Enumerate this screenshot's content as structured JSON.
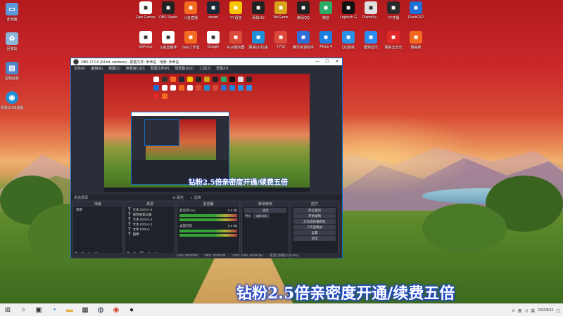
{
  "desktop": {
    "icons_row1": [
      {
        "label": "Epic Games",
        "icon": "epic-icon",
        "color": "#ffffff"
      },
      {
        "label": "OBS Studio",
        "icon": "obs-icon",
        "color": "#222222"
      },
      {
        "label": "斗鱼直播",
        "icon": "douyu-icon",
        "color": "#f26b21"
      },
      {
        "label": "steam",
        "icon": "steam-icon",
        "color": "#1b2838"
      },
      {
        "label": "YY语音",
        "icon": "yy-icon",
        "color": "#f7c600"
      },
      {
        "label": "网易UU",
        "icon": "uu-icon",
        "color": "#222222"
      },
      {
        "label": "WeGame",
        "icon": "wegame-icon",
        "color": "#d7a31a"
      },
      {
        "label": "腾讯QQ",
        "icon": "qq-icon",
        "color": "#222222"
      },
      {
        "label": "微信",
        "icon": "wechat-icon",
        "color": "#2aae67"
      },
      {
        "label": "Logitech G",
        "icon": "logitech-icon",
        "color": "#111111"
      },
      {
        "label": "PlantsVs...",
        "icon": "pvz-icon",
        "color": "#e0e0e0"
      },
      {
        "label": "YY开播",
        "icon": "yy-live-icon",
        "color": "#2a2a2a"
      },
      {
        "label": "FlashFXP",
        "icon": "flashfxp-icon",
        "color": "#1e6fd6"
      }
    ],
    "icons_row2": [
      {
        "label": "GeForce",
        "icon": "document-icon",
        "color": "#ffffff"
      },
      {
        "label": "斗鱼直播伴",
        "icon": "douyu-companion-icon",
        "color": "#ffffff"
      },
      {
        "label": "Sam工作室",
        "icon": "sam-icon",
        "color": "#f26b21"
      },
      {
        "label": "Google",
        "icon": "chrome-icon",
        "color": "#ffffff"
      },
      {
        "label": "Rust服务器",
        "icon": "rust-icon",
        "color": "#d94a3a"
      },
      {
        "label": "网易UU加速",
        "icon": "uu-accel-icon",
        "color": "#1f8fd6"
      },
      {
        "label": "YY(2)",
        "icon": "yy2-icon",
        "color": "#d94a3a"
      },
      {
        "label": "腾讯手游助手",
        "icon": "tencent-game-icon",
        "color": "#2d6fd6"
      },
      {
        "label": "Photo 4",
        "icon": "photo-icon",
        "color": "#1e7fe0"
      },
      {
        "label": "QQ游戏",
        "icon": "qqgame-icon",
        "color": "#2a90e6"
      },
      {
        "label": "酷狗音乐",
        "icon": "kugou-icon",
        "color": "#2a8ff0"
      },
      {
        "label": "网易云音乐",
        "icon": "netease-music-icon",
        "color": "#e02a2a"
      },
      {
        "label": "网易邮",
        "icon": "mail-icon",
        "color": "#f26b21"
      }
    ],
    "left_icons": [
      {
        "label": "此电脑",
        "icon": "computer-icon"
      },
      {
        "label": "回收站",
        "icon": "recycle-bin-icon"
      },
      {
        "label": "控制面板",
        "icon": "control-panel-icon"
      },
      {
        "label": "网易UU加速器",
        "icon": "uu-left-icon"
      }
    ]
  },
  "obs": {
    "title": "OBS 27.0.0 (64-bit, windows) - 配置文件: 未命名 - 场景: 未命名",
    "menu": [
      "文件(F)",
      "编辑(E)",
      "视图(V)",
      "停靠窗口(D)",
      "配置文件(P)",
      "场景集合(S)",
      "工具(T)",
      "帮助(H)"
    ],
    "preview_caption": "钻粉2.5倍亲密度开通/续费五倍",
    "dock_row": {
      "label": "未选择源",
      "properties": "属性",
      "filters": "滤镜"
    },
    "docks": {
      "scenes": {
        "title": "场景",
        "items": [
          "场景"
        ]
      },
      "sources": {
        "title": "来源",
        "items": [
          {
            "type": "T",
            "name": "文本 (GDI+) 4"
          },
          {
            "type": "T",
            "name": "视频采集设备"
          },
          {
            "type": "T",
            "name": "文本 (GDI+) 3"
          },
          {
            "type": "T",
            "name": "文本 (GDI+) 2"
          },
          {
            "type": "T",
            "name": "文本 (GDI+)"
          },
          {
            "type": "T",
            "name": "图像"
          }
        ]
      },
      "mixer": {
        "title": "混音器",
        "channels": [
          {
            "name": "麦克风/Aux",
            "level": "0.0 dB"
          },
          {
            "name": "桌面音频",
            "level": "0.0 dB"
          }
        ]
      },
      "transitions": {
        "title": "转场特效",
        "type": "淡出",
        "duration_label": "时长",
        "duration": "300 ms"
      },
      "controls": {
        "title": "控件",
        "buttons": [
          "停止推流",
          "开始录制",
          "启动虚拟摄像机",
          "工作室模式",
          "设置",
          "退出"
        ]
      }
    },
    "status": {
      "live": "LIVE: 00:00:00",
      "rec": "REC: 00:00:00",
      "cpu": "CPU: 0.9%, 60.00 fps",
      "delay": "延迟 (丢帧) 0 (0.0%)"
    }
  },
  "caption": "钻粉2.5倍亲密度开通/续费五倍",
  "taskbar": {
    "apps": [
      "windows-start-icon",
      "search-icon",
      "task-view-icon",
      "edge-icon",
      "file-explorer-icon",
      "store-icon",
      "steam-task-icon",
      "chrome-task-icon",
      "obs-task-icon"
    ],
    "tray": {
      "ime": "英",
      "time": "",
      "date": "2022/8/13"
    }
  }
}
